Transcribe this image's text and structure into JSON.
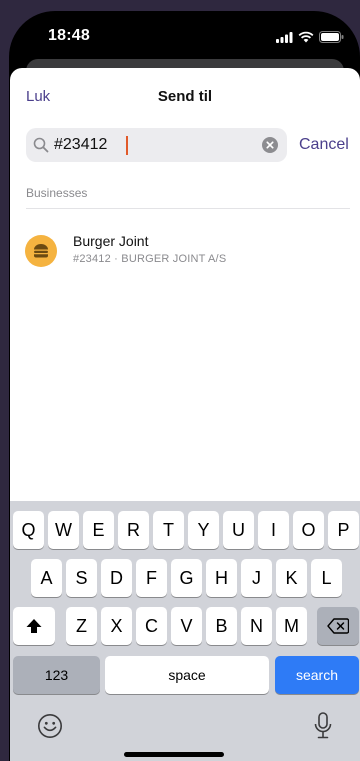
{
  "status_bar": {
    "time": "18:48"
  },
  "nav": {
    "close_label": "Luk",
    "title": "Send til"
  },
  "search": {
    "value": "#23412",
    "cancel_label": "Cancel"
  },
  "section": {
    "header": "Businesses"
  },
  "results": [
    {
      "name": "Burger Joint",
      "subtitle": "#23412 · BURGER JOINT A/S"
    }
  ],
  "keyboard": {
    "row1": [
      "Q",
      "W",
      "E",
      "R",
      "T",
      "Y",
      "U",
      "I",
      "O",
      "P"
    ],
    "row2": [
      "A",
      "S",
      "D",
      "F",
      "G",
      "H",
      "J",
      "K",
      "L"
    ],
    "row3": [
      "Z",
      "X",
      "C",
      "V",
      "B",
      "N",
      "M"
    ],
    "numbers_label": "123",
    "space_label": "space",
    "search_label": "search"
  },
  "colors": {
    "accent": "#4b3f8c",
    "caret": "#e15a2a",
    "search_key": "#2e7bf6",
    "avatar": "#f5b340"
  }
}
